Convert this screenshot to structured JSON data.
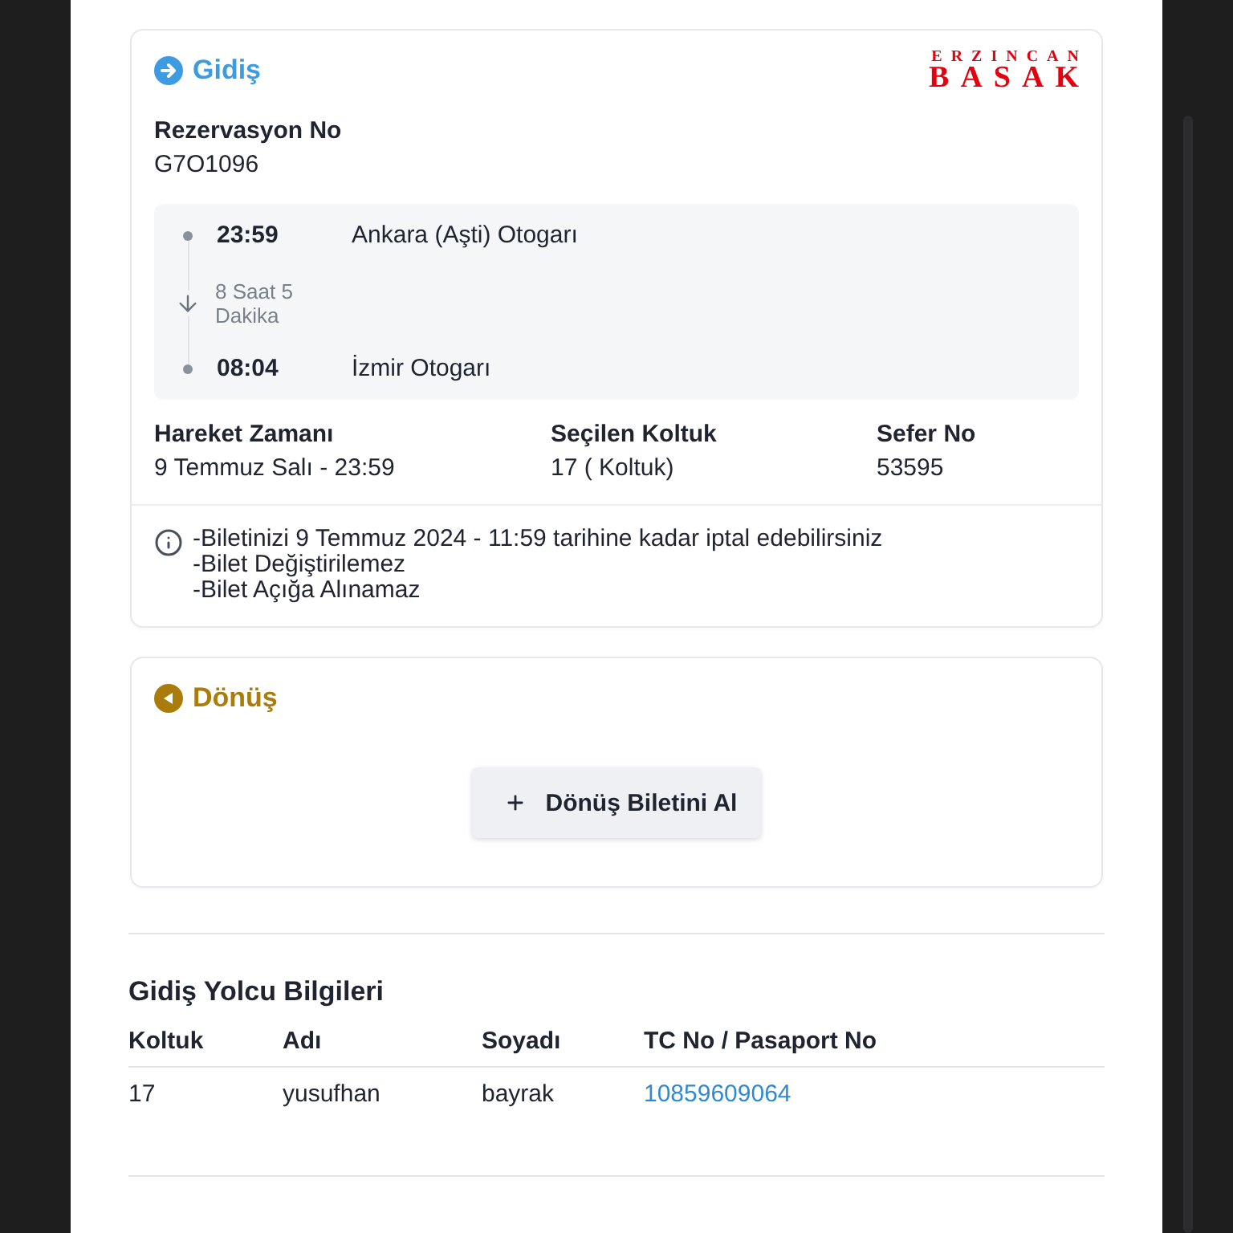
{
  "outbound_card": {
    "title": "Gidiş",
    "logo": {
      "line_1": "ERZINCAN",
      "line_2": "BASAK"
    },
    "reservation": {
      "label": "Rezervasyon No",
      "value": "G7O1096"
    },
    "route": {
      "stops": [
        {
          "time": "23:59",
          "station": "Ankara (Aşti) Otogarı"
        },
        {
          "time": "08:04",
          "station": "İzmir Otogarı"
        }
      ],
      "duration": "8 Saat 5 Dakika"
    },
    "details": [
      {
        "label": "Hareket Zamanı",
        "value": "9 Temmuz Salı - 23:59"
      },
      {
        "label": "Seçilen Koltuk",
        "value": "17 ( Koltuk)"
      },
      {
        "label": "Sefer No",
        "value": "53595"
      }
    ],
    "notes": [
      "-Biletinizi 9 Temmuz 2024 - 11:59 tarihine kadar iptal edebilirsiniz",
      "-Bilet Değiştirilemez",
      "-Bilet Açığa Alınamaz"
    ]
  },
  "return_card": {
    "title": "Dönüş",
    "button": "Dönüş Biletini Al"
  },
  "passengers": {
    "title": "Gidiş Yolcu Bilgileri",
    "columns": [
      "Koltuk",
      "Adı",
      "Soyadı",
      "TC No / Pasaport No"
    ],
    "rows": [
      {
        "seat": "17",
        "first_name": "yusufhan",
        "last_name": "bayrak",
        "id_number": "10859609064"
      }
    ]
  }
}
